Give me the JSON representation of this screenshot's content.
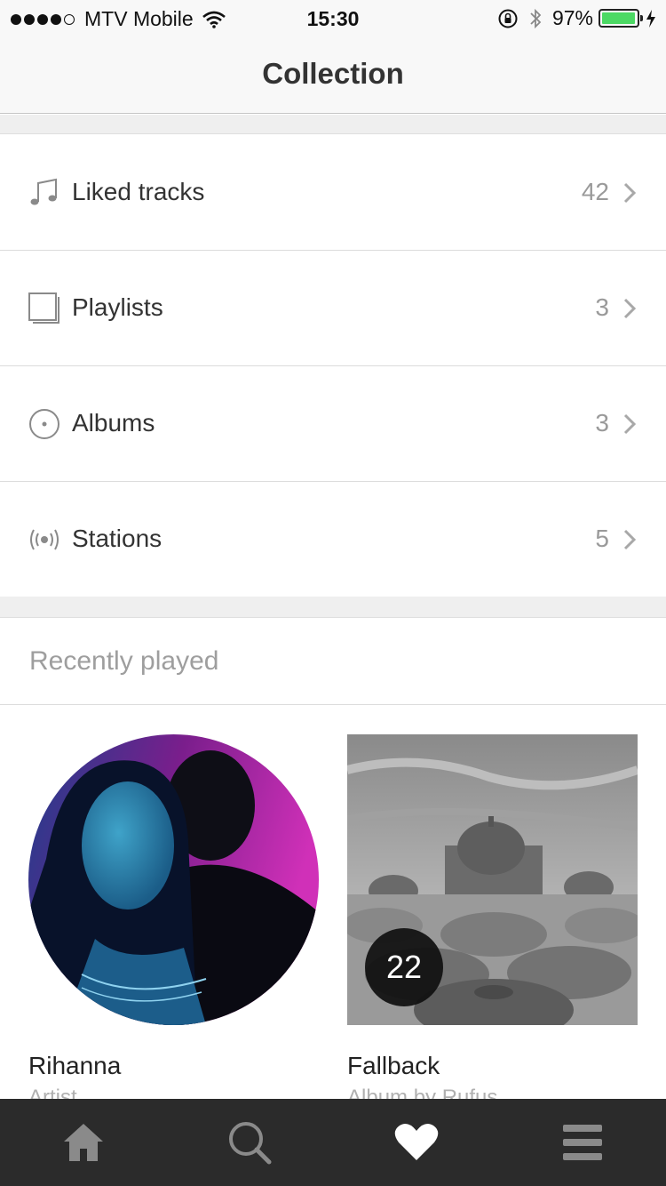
{
  "status_bar": {
    "carrier": "MTV Mobile",
    "time": "15:30",
    "battery_percent": "97%",
    "battery_level": 0.97,
    "signal_bars_filled": 4,
    "signal_bars_total": 5,
    "icons": [
      "wifi-icon",
      "rotation-lock-icon",
      "bluetooth-icon",
      "battery-icon",
      "charging-icon"
    ]
  },
  "nav": {
    "title": "Collection"
  },
  "collection": {
    "items": [
      {
        "label": "Liked tracks",
        "count": "42",
        "icon": "music-note-icon"
      },
      {
        "label": "Playlists",
        "count": "3",
        "icon": "playlist-icon"
      },
      {
        "label": "Albums",
        "count": "3",
        "icon": "album-disc-icon"
      },
      {
        "label": "Stations",
        "count": "5",
        "icon": "station-broadcast-icon"
      }
    ]
  },
  "recent": {
    "title": "Recently played",
    "items": [
      {
        "title": "Rihanna",
        "subtitle": "Artist"
      },
      {
        "title": "Fallback",
        "subtitle": "Album by Rufus",
        "badge": "22"
      }
    ]
  },
  "tab_bar": {
    "tabs": [
      {
        "icon": "home-icon",
        "active": false
      },
      {
        "icon": "search-icon",
        "active": false
      },
      {
        "icon": "heart-icon",
        "active": true
      },
      {
        "icon": "menu-icon",
        "active": false
      }
    ]
  },
  "colors": {
    "accent": "#4cd964",
    "tab_bar_bg": "#2b2b2b",
    "tab_inactive": "#8a8a8a",
    "tab_active": "#ffffff",
    "text_muted": "#9a9a9a"
  }
}
